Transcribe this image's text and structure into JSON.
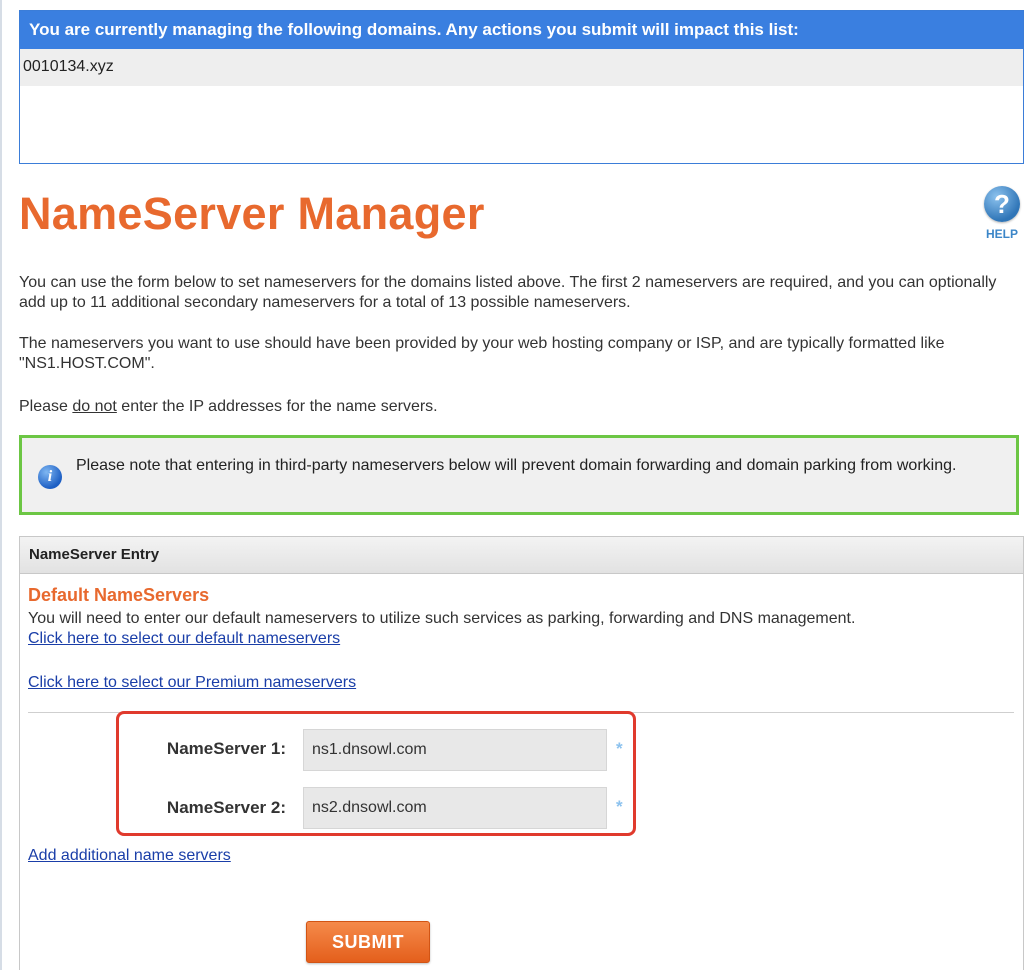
{
  "domains": {
    "header": "You are currently managing the following domains. Any actions you submit will impact this list:",
    "items": [
      "0010134.xyz"
    ]
  },
  "page": {
    "title": "NameServer Manager",
    "help_label": "HELP",
    "help_glyph": "?"
  },
  "intro": {
    "p1": "You can use the form below to set nameservers for the domains listed above. The first 2 nameservers are required, and you can optionally add up to 11 additional secondary nameservers for a total of 13 possible nameservers.",
    "p2": "The nameservers you want to use should have been provided by your web hosting company or ISP, and are typically formatted like \"NS1.HOST.COM\".",
    "p3_before": "Please ",
    "p3_underline": "do not",
    "p3_after": " enter the IP addresses for the name servers."
  },
  "notice": {
    "icon": "info-icon",
    "text": "Please note that entering in third-party nameservers below will prevent domain forwarding and domain parking from working."
  },
  "entry": {
    "header": "NameServer Entry",
    "section_title": "Default NameServers",
    "section_text": "You will need to enter our default nameservers to utilize such services as parking, forwarding and DNS management.",
    "default_link": "Click here to select our default nameservers",
    "premium_link": "Click here to select our Premium nameservers",
    "ns1_label": "NameServer 1:",
    "ns1_value": "ns1.dnsowl.com",
    "ns2_label": "NameServer 2:",
    "ns2_value": "ns2.dnsowl.com",
    "required_marker": "*",
    "add_link": "Add additional name servers",
    "submit_label": "SUBMIT"
  },
  "colors": {
    "header_blue": "#3a7fe0",
    "title_orange": "#e8692e",
    "notice_green": "#6cc644",
    "highlight_red": "#e03a2d",
    "link_blue": "#1a3ea8"
  }
}
